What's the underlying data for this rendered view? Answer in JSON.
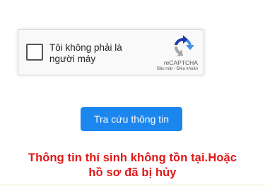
{
  "recaptcha": {
    "label": "Tôi không phải là người máy",
    "brand": "reCAPTCHA",
    "terms": "Bảo mật - Điều khoản",
    "icon": "recaptcha-logo-icon"
  },
  "lookup_button": {
    "label": "Tra cứu thông tin",
    "color": "#1b86ee"
  },
  "error": {
    "line1": "Thông tin thí sinh không tồn tại.Hoặc",
    "line2": "hồ sơ đã bị hủy",
    "color": "#e01616"
  }
}
